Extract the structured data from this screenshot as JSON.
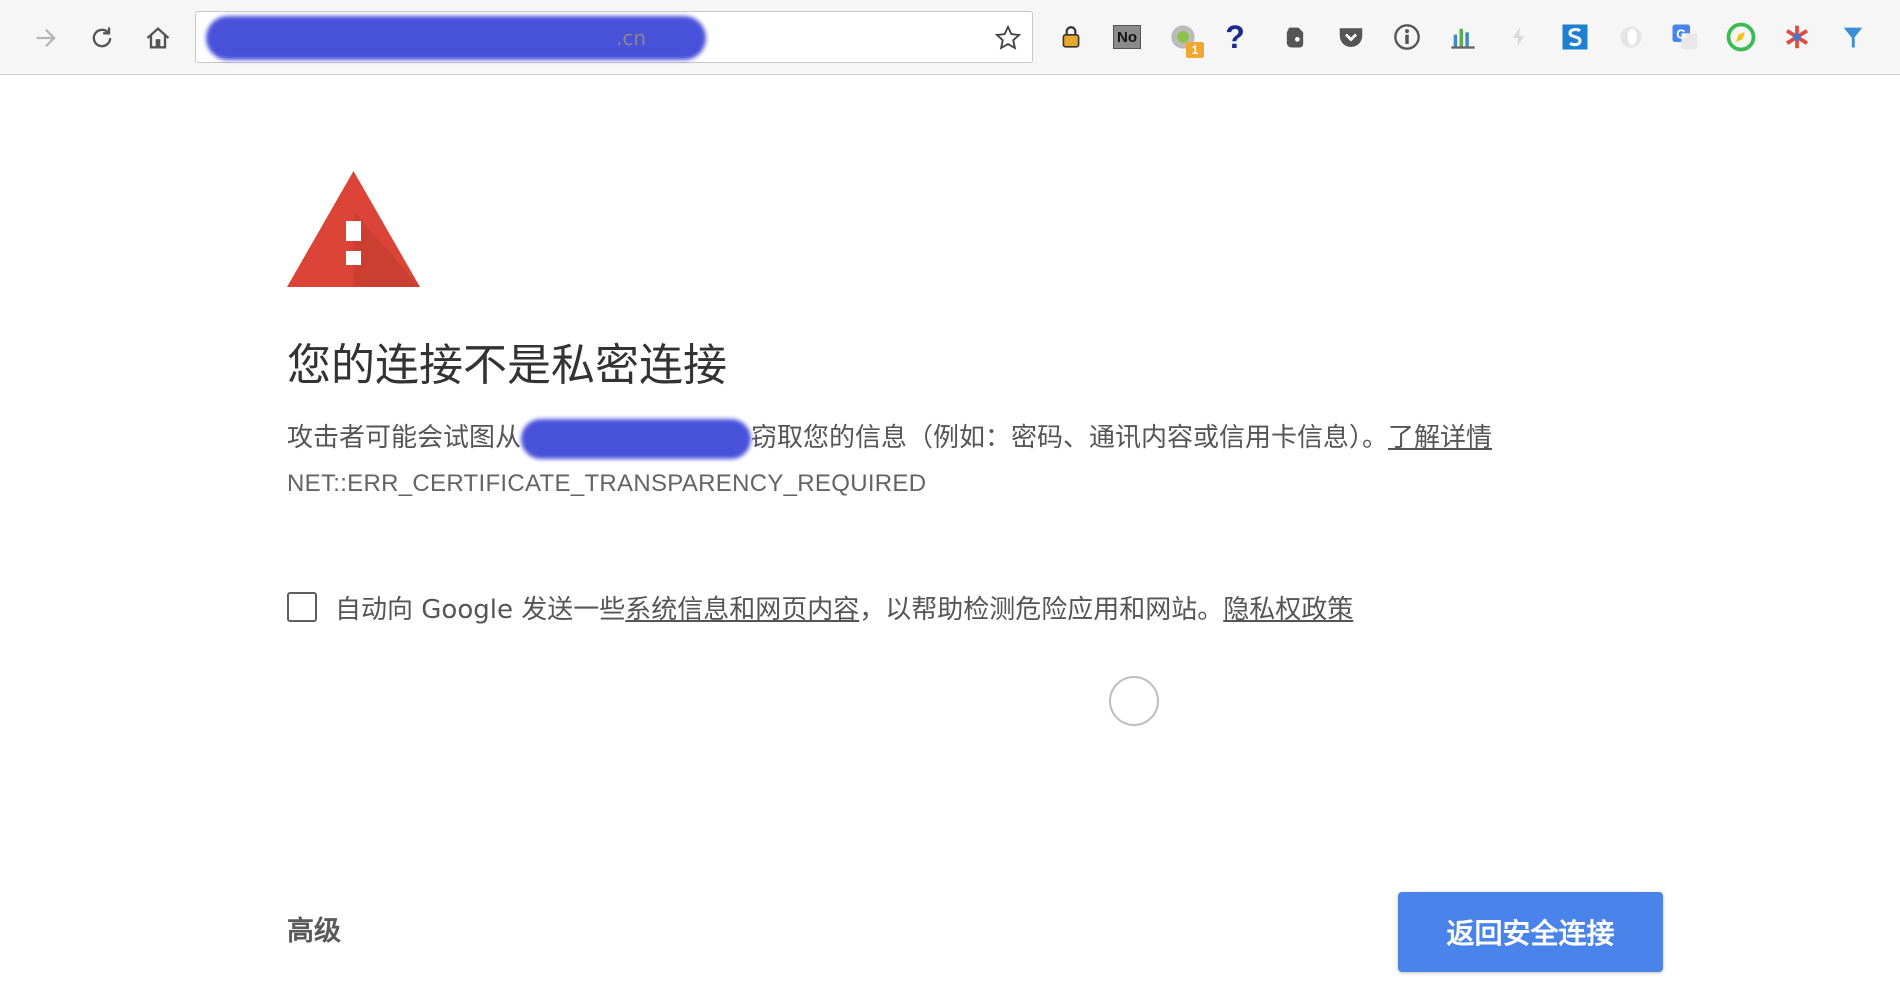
{
  "omnibox": {
    "url_suffix": ".cn"
  },
  "icons": {
    "bookmark": "star-icon",
    "extensions": [
      "lock-extension-icon",
      "noscript-extension-icon",
      "badge-extension-icon",
      "help-extension-icon",
      "evernote-extension-icon",
      "pocket-extension-icon",
      "info-extension-icon",
      "chart-extension-icon",
      "lightning-extension-icon",
      "s-extension-icon",
      "opera-extension-icon",
      "google-translate-extension-icon",
      "compass-extension-icon",
      "asterisk-extension-icon",
      "y-extension-icon"
    ]
  },
  "extensions": {
    "noscript_label": "No",
    "badge_count": "1",
    "help_label": "?"
  },
  "interstitial": {
    "heading": "您的连接不是私密连接",
    "explanation_before": "攻击者可能会试图从",
    "explanation_after": "窃取您的信息（例如：密码、通讯内容或信用卡信息）。",
    "learn_more_link": "了解详情",
    "error_code": "NET::ERR_CERTIFICATE_TRANSPARENCY_REQUIRED",
    "checkbox_text_before": "自动向 Google 发送一些",
    "checkbox_link": "系统信息和网页内容",
    "checkbox_text_middle": "，以帮助检测危险应用和网站。",
    "privacy_link": "隐私权政策",
    "advanced_button": "高级",
    "back_button": "返回安全连接"
  },
  "colors": {
    "warning_red": "#db4437",
    "primary_blue": "#4a84ea",
    "redaction_blue": "#3f48d8"
  }
}
